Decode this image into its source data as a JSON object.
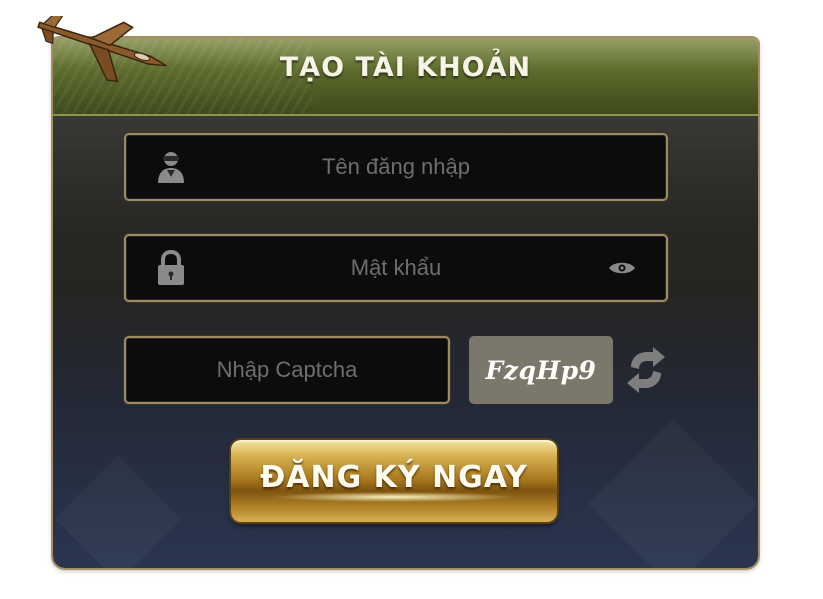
{
  "header": {
    "title": "TẠO TÀI KHOẢN",
    "emblem_icon": "fighter-plane-icon"
  },
  "form": {
    "username": {
      "placeholder": "Tên đăng nhập",
      "value": "",
      "icon": "user-icon"
    },
    "password": {
      "placeholder": "Mật khẩu",
      "value": "",
      "icon": "lock-icon",
      "toggle_icon": "eye-icon"
    },
    "captcha": {
      "placeholder": "Nhập Captcha",
      "value": "",
      "code": "FzqHp9",
      "refresh_icon": "refresh-icon"
    },
    "submit_label": "ĐĂNG KÝ NGAY"
  },
  "colors": {
    "header_green": "#5c6a2c",
    "panel_dark": "#262522",
    "field_border": "#9c8a66",
    "button_gold": "#a9781d",
    "captcha_bg": "#7b776a"
  }
}
